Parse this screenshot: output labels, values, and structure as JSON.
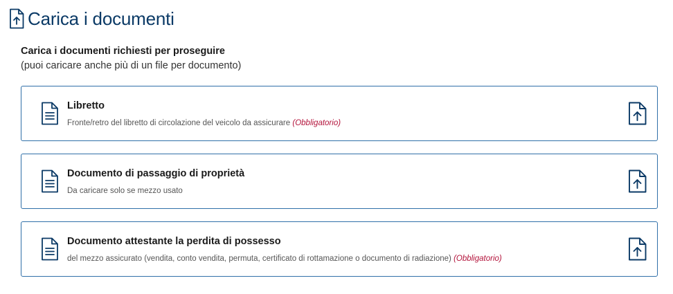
{
  "header": {
    "icon": "file-upload-icon",
    "title": "Carica i documenti"
  },
  "intro": {
    "heading": "Carica i documenti richiesti per proseguire",
    "subheading": "(puoi caricare anche più di un file per documento)"
  },
  "documents": [
    {
      "title": "Libretto",
      "description": "Fronte/retro del libretto di circolazione del veicolo da assicurare",
      "required_label": "(Obbligatorio)"
    },
    {
      "title": "Documento di passaggio di proprietà",
      "description": "Da caricare solo se mezzo usato",
      "required_label": ""
    },
    {
      "title": "Documento attestante la perdita di possesso",
      "description": "del mezzo assicurato (vendita, conto vendita, permuta, certificato di rottamazione o documento di radiazione)",
      "required_label": "(Obbligatorio)"
    }
  ],
  "colors": {
    "accent": "#0b3a66",
    "border": "#2f6fa8",
    "required": "#b3123a"
  }
}
